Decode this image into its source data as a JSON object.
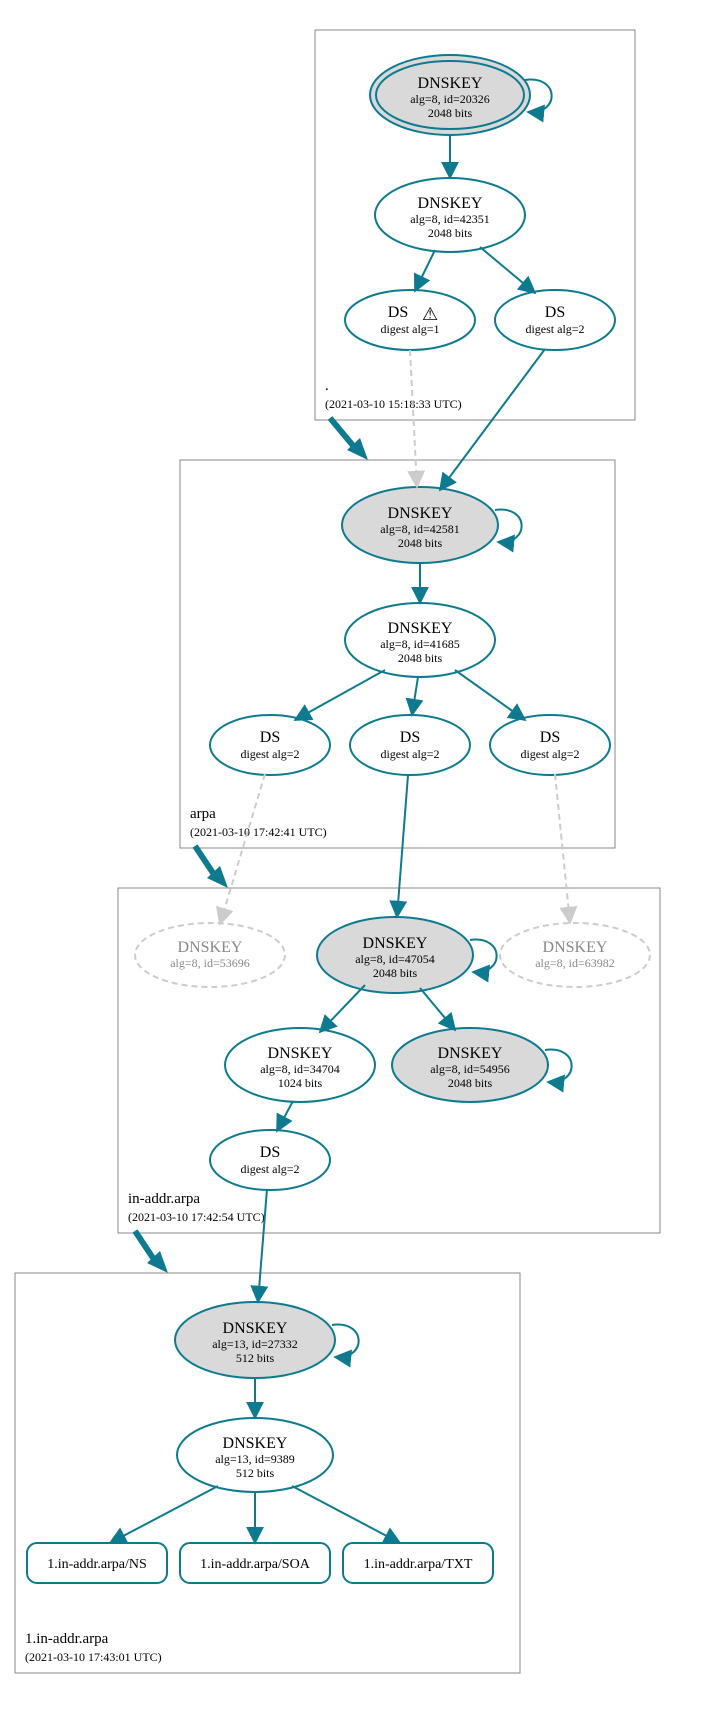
{
  "zones": {
    "root": {
      "label": ".",
      "timestamp": "(2021-03-10 15:18:33 UTC)"
    },
    "arpa": {
      "label": "arpa",
      "timestamp": "(2021-03-10 17:42:41 UTC)"
    },
    "inaddr": {
      "label": "in-addr.arpa",
      "timestamp": "(2021-03-10 17:42:54 UTC)"
    },
    "one": {
      "label": "1.in-addr.arpa",
      "timestamp": "(2021-03-10 17:43:01 UTC)"
    }
  },
  "nodes": {
    "root_ksk": {
      "title": "DNSKEY",
      "l2": "alg=8, id=20326",
      "l3": "2048 bits"
    },
    "root_zsk": {
      "title": "DNSKEY",
      "l2": "alg=8, id=42351",
      "l3": "2048 bits"
    },
    "root_ds1": {
      "title": "DS",
      "l2": "digest alg=1",
      "warning": "⚠"
    },
    "root_ds2": {
      "title": "DS",
      "l2": "digest alg=2"
    },
    "arpa_ksk": {
      "title": "DNSKEY",
      "l2": "alg=8, id=42581",
      "l3": "2048 bits"
    },
    "arpa_zsk": {
      "title": "DNSKEY",
      "l2": "alg=8, id=41685",
      "l3": "2048 bits"
    },
    "arpa_ds_a": {
      "title": "DS",
      "l2": "digest alg=2"
    },
    "arpa_ds_b": {
      "title": "DS",
      "l2": "digest alg=2"
    },
    "arpa_ds_c": {
      "title": "DS",
      "l2": "digest alg=2"
    },
    "in_dkA": {
      "title": "DNSKEY",
      "l2": "alg=8, id=53696"
    },
    "in_ksk": {
      "title": "DNSKEY",
      "l2": "alg=8, id=47054",
      "l3": "2048 bits"
    },
    "in_dkC": {
      "title": "DNSKEY",
      "l2": "alg=8, id=63982"
    },
    "in_zsk": {
      "title": "DNSKEY",
      "l2": "alg=8, id=34704",
      "l3": "1024 bits"
    },
    "in_dkE": {
      "title": "DNSKEY",
      "l2": "alg=8, id=54956",
      "l3": "2048 bits"
    },
    "in_ds": {
      "title": "DS",
      "l2": "digest alg=2"
    },
    "one_ksk": {
      "title": "DNSKEY",
      "l2": "alg=13, id=27332",
      "l3": "512 bits"
    },
    "one_zsk": {
      "title": "DNSKEY",
      "l2": "alg=13, id=9389",
      "l3": "512 bits"
    },
    "rr_ns": {
      "title": "1.in-addr.arpa/NS"
    },
    "rr_soa": {
      "title": "1.in-addr.arpa/SOA"
    },
    "rr_txt": {
      "title": "1.in-addr.arpa/TXT"
    }
  }
}
